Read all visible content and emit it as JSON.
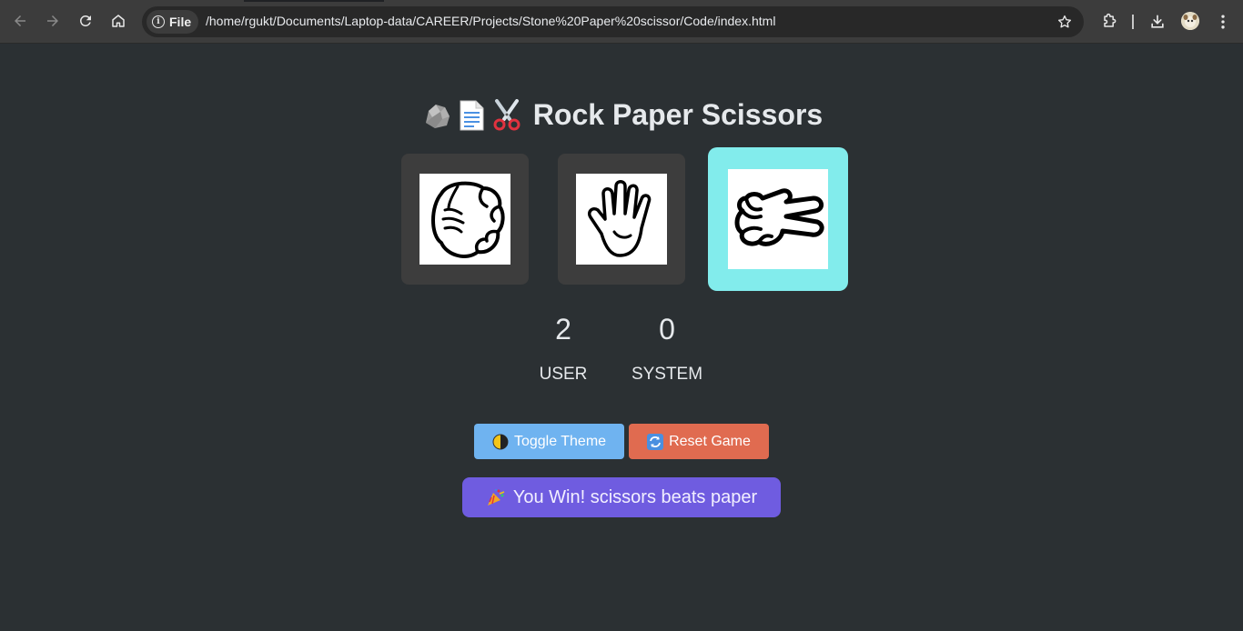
{
  "browser": {
    "site_chip_label": "File",
    "url": "/home/rgukt/Documents/Laptop-data/CAREER/Projects/Stone%20Paper%20scissor/Code/index.html",
    "icons": [
      "back-arrow-icon",
      "forward-arrow-icon",
      "reload-icon",
      "home-icon",
      "info-icon",
      "bookmark-star-icon",
      "extensions-puzzle-icon",
      "download-icon",
      "profile-avatar-icon",
      "kebab-menu-icon"
    ]
  },
  "game": {
    "title": "Rock Paper Scissors",
    "title_emojis": [
      "rock-emoji",
      "page-emoji",
      "scissors-emoji"
    ],
    "choices": [
      {
        "name": "rock",
        "icon": "fist-hand-icon",
        "selected": false
      },
      {
        "name": "paper",
        "icon": "open-hand-icon",
        "selected": false
      },
      {
        "name": "scissors",
        "icon": "peace-hand-icon",
        "selected": true
      }
    ],
    "scores": {
      "user": {
        "value": "2",
        "label": "USER"
      },
      "system": {
        "value": "0",
        "label": "SYSTEM"
      }
    },
    "buttons": {
      "toggle_theme": "Toggle Theme",
      "reset_game": "Reset Game"
    },
    "result_message": "You Win! scissors beats paper"
  },
  "colors": {
    "page_bg": "#2b3033",
    "choice_bg": "#3d3d3d",
    "selected_bg": "#82ecec",
    "toggle_btn": "#6fb3f0",
    "reset_btn": "#e06b50",
    "result_bg": "#6f5ce0"
  }
}
